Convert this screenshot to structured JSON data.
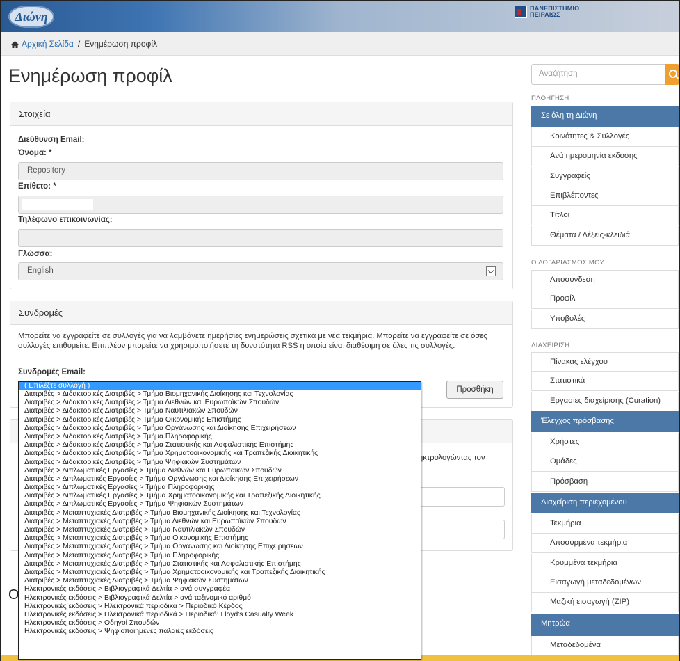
{
  "header": {
    "logo_text": "Διώνη",
    "university": "ΠΑΝΕΠΙΣΤΗΜΙΟ",
    "university_sub": "ΠΕΙΡΑΙΩΣ"
  },
  "breadcrumb": {
    "home": "Αρχική Σελίδα",
    "separator": "/",
    "current": "Ενημέρωση προφίλ"
  },
  "page_title": "Ενημέρωση προφίλ",
  "details": {
    "heading": "Στοιχεία",
    "email_label": "Διεύθυνση Email:",
    "first_name_label": "Όνομα: *",
    "first_name_value": "Repository",
    "last_name_label": "Επίθετο: *",
    "phone_label": "Τηλέφωνο επικοινωνίας:",
    "language_label": "Γλώσσα:",
    "language_value": "English"
  },
  "subscriptions": {
    "heading": "Συνδρομές",
    "text": "Μπορείτε να εγγραφείτε σε συλλογές για να λαμβάνετε ημερήσιες ενημερώσεις σχετικά με νέα τεκμήρια. Μπορείτε να εγγραφείτε σε όσες συλλογές επιθυμείτε. Επιπλέον μπορείτε να χρησιμοποιήσετε τη δυνατότητα RSS η οποία είναι διαθέσιμη σε όλες τις συλλογές.",
    "email_label": "Συνδρομές Email:",
    "add_button": "Προσθήκη",
    "partial_text": "ηκτρολογώντας τον"
  },
  "dropdown_options": [
    "( Επιλέξτε συλλογή )",
    "Διατριβές > Διδακτορικές Διατριβές > Τμήμα Βιομηχανικής Διοίκησης και Τεχνολογίας",
    "Διατριβές > Διδακτορικές Διατριβές > Τμήμα Διεθνών και Ευρωπαϊκών Σπουδών",
    "Διατριβές > Διδακτορικές Διατριβές > Τμήμα Ναυτιλιακών Σπουδών",
    "Διατριβές > Διδακτορικές Διατριβές > Τμήμα Οικονομικής Επιστήμης",
    "Διατριβές > Διδακτορικές Διατριβές > Τμήμα Οργάνωσης και Διοίκησης Επιχειρήσεων",
    "Διατριβές > Διδακτορικές Διατριβές > Τμήμα Πληροφορικής",
    "Διατριβές > Διδακτορικές Διατριβές > Τμήμα Στατιστικής και Ασφαλιστικής Επιστήμης",
    "Διατριβές > Διδακτορικές Διατριβές > Τμήμα Χρηματοοικονομικής και Τραπεζικής Διοικητικής",
    "Διατριβές > Διδακτορικές Διατριβές > Τμήμα Ψηφιακών Συστημάτων",
    "Διατριβές > Διπλωματικές Εργασίες > Τμήμα Διεθνών και Ευρωπαϊκών Σπουδών",
    "Διατριβές > Διπλωματικές Εργασίες > Τμήμα Οργάνωσης και Διοίκησης Επιχειρήσεων",
    "Διατριβές > Διπλωματικές Εργασίες > Τμήμα Πληροφορικής",
    "Διατριβές > Διπλωματικές Εργασίες > Τμήμα Χρηματοοικονομικής και Τραπεζικής Διοικητικής",
    "Διατριβές > Διπλωματικές Εργασίες > Τμήμα Ψηφιακών Συστημάτων",
    "Διατριβές > Μεταπτυχιακές Διατριβές > Τμήμα Βιομηχανικής Διοίκησης και Τεχνολογίας",
    "Διατριβές > Μεταπτυχιακές Διατριβές > Τμήμα Διεθνών και Ευρωπαϊκών Σπουδών",
    "Διατριβές > Μεταπτυχιακές Διατριβές > Τμήμα Ναυτιλιακών Σπουδών",
    "Διατριβές > Μεταπτυχιακές Διατριβές > Τμήμα Οικονομικής Επιστήμης",
    "Διατριβές > Μεταπτυχιακές Διατριβές > Τμήμα Οργάνωσης και Διοίκησης Επιχειρήσεων",
    "Διατριβές > Μεταπτυχιακές Διατριβές > Τμήμα Πληροφορικής",
    "Διατριβές > Μεταπτυχιακές Διατριβές > Τμήμα Στατιστικής και Ασφαλιστικής Επιστήμης",
    "Διατριβές > Μεταπτυχιακές Διατριβές > Τμήμα Χρηματοοικονομικής και Τραπεζικής Διοικητικής",
    "Διατριβές > Μεταπτυχιακές Διατριβές > Τμήμα Ψηφιακών Συστημάτων",
    "Ηλεκτρονικές εκδόσεις > Βιβλιογραφικά Δελτία > ανά συγγραφέα",
    "Ηλεκτρονικές εκδόσεις > Βιβλιογραφικά Δελτία > ανά ταξινομικό αριθμό",
    "Ηλεκτρονικές εκδόσεις > Ηλεκτρονικά περιοδικά > Περιοδικό Κέρδος",
    "Ηλεκτρονικές εκδόσεις > Ηλεκτρονικά περιοδικά > Περιοδικό: Lloyd's Casualty Week",
    "Ηλεκτρονικές εκδόσεις > Οδηγοί Σπουδών",
    "Ηλεκτρονικές εκδόσεις > Ψηφιοποιημένες παλαιές εκδόσεις"
  ],
  "sidebar": {
    "search_placeholder": "Αναζήτηση",
    "nav_heading": "ΠΛΟΗΓΗΣΗ",
    "nav_active": "Σε όλη τη Διώνη",
    "nav_items": [
      "Κοινότητες & Συλλογές",
      "Ανά ημερομηνία έκδοσης",
      "Συγγραφείς",
      "Επιβλέποντες",
      "Τίτλοι",
      "Θέματα / Λέξεις-κλειδιά"
    ],
    "account_heading": "Ο ΛΟΓΑΡΙΑΣΜΟΣ ΜΟΥ",
    "account_items": [
      "Αποσύνδεση",
      "Προφίλ",
      "Υποβολές"
    ],
    "admin_heading": "ΔΙΑΧΕΙΡΙΣΗ",
    "admin_items": [
      "Πίνακας ελέγχου",
      "Στατιστικά",
      "Εργασίες διαχείρισης (Curation)"
    ],
    "access_heading": "Έλεγχος πρόσβασης",
    "access_items": [
      "Χρήστες",
      "Ομάδες",
      "Πρόσβαση"
    ],
    "content_heading": "Διαχείριση περιεχομένου",
    "content_items": [
      "Τεκμήρια",
      "Αποσυρμένα τεκμήρια",
      "Κρυμμένα τεκμήρια",
      "Εισαγωγή μεταδεδομένων",
      "Μαζική εισαγωγή (ZIP)"
    ],
    "registry_heading": "Μητρώα",
    "registry_items": [
      "Μεταδεδομένα"
    ]
  },
  "colors": {
    "accent_blue": "#4b78a6",
    "search_button": "#f0a030",
    "selected_option": "#3399ff"
  }
}
